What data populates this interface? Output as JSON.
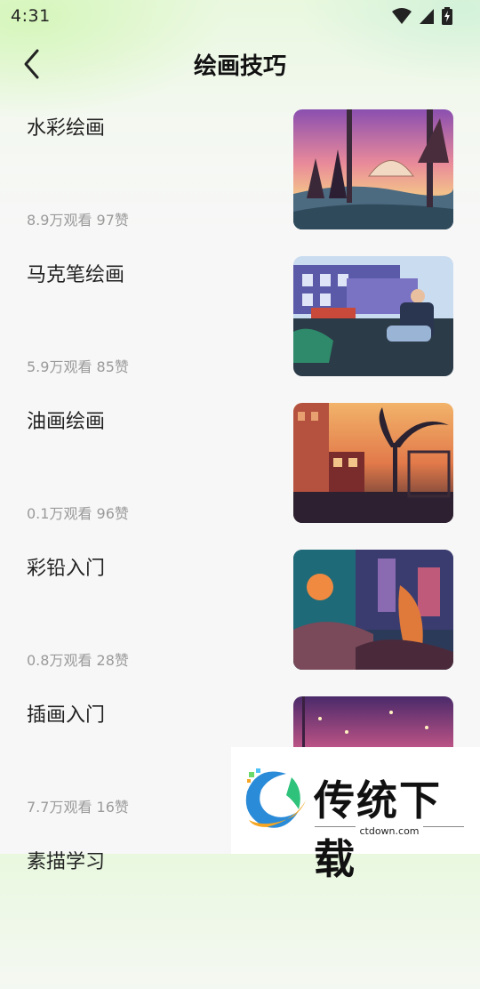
{
  "status": {
    "time": "4:31"
  },
  "header": {
    "title": "绘画技巧",
    "back_icon": "chevron-left-icon"
  },
  "items": [
    {
      "title": "水彩绘画",
      "stats": "8.9万观看 97赞"
    },
    {
      "title": "马克笔绘画",
      "stats": "5.9万观看 85赞"
    },
    {
      "title": "油画绘画",
      "stats": "0.1万观看 96赞"
    },
    {
      "title": "彩铅入门",
      "stats": "0.8万观看 28赞"
    },
    {
      "title": "插画入门",
      "stats": "7.7万观看 16赞"
    },
    {
      "title": "素描学习",
      "stats": ""
    }
  ],
  "watermark": {
    "brand": "传统下载",
    "url": "ctdown.com"
  },
  "colors": {
    "title": "#111111",
    "item_text": "#222222",
    "stats_text": "#9a9a9a",
    "background": "#f7f7f7",
    "header_tint": "#e9f8df"
  }
}
